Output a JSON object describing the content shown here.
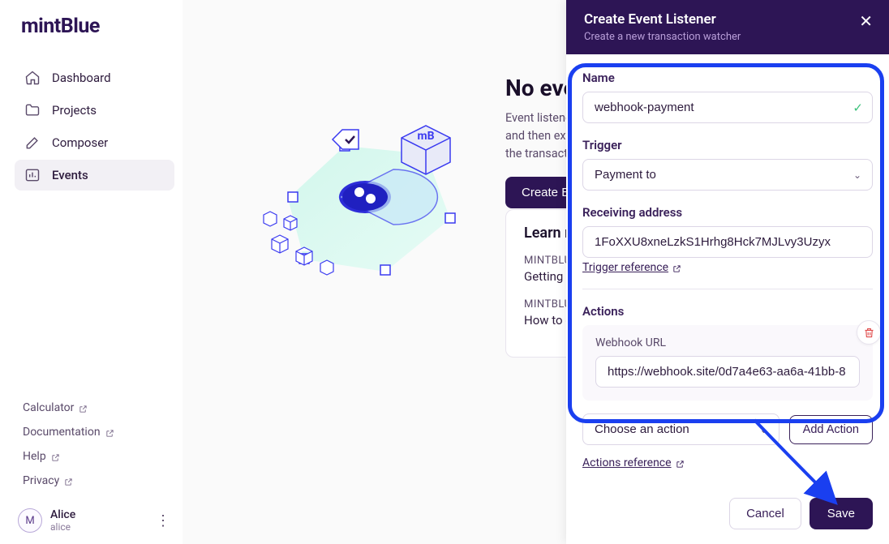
{
  "brand": "mintBlue",
  "sidebar": {
    "nav": [
      {
        "label": "Dashboard",
        "name": "sidebar-item-dashboard"
      },
      {
        "label": "Projects",
        "name": "sidebar-item-projects"
      },
      {
        "label": "Composer",
        "name": "sidebar-item-composer"
      },
      {
        "label": "Events",
        "name": "sidebar-item-events"
      }
    ],
    "links": [
      {
        "label": "Calculator"
      },
      {
        "label": "Documentation"
      },
      {
        "label": "Help"
      },
      {
        "label": "Privacy"
      }
    ],
    "user": {
      "initial": "M",
      "name": "Alice",
      "handle": "alice"
    }
  },
  "main": {
    "title": "No events",
    "desc_line1": "Event listeners watch for conditions",
    "desc_line2": "and then execute actions based on",
    "desc_line3": "the transactions.",
    "create_button": "Create Event",
    "learn_title": "Learn more",
    "learn_items": [
      {
        "tag": "MINTBLUE",
        "text": "Getting started"
      },
      {
        "tag": "MINTBLUE",
        "text": "How to create"
      }
    ]
  },
  "panel": {
    "title": "Create Event Listener",
    "subtitle": "Create a new transaction watcher",
    "name_label": "Name",
    "name_value": "webhook-payment",
    "trigger_label": "Trigger",
    "trigger_value": "Payment to",
    "address_label": "Receiving address",
    "address_value": "1FoXXU8xneLzkS1Hrhg8Hck7MJLvy3Uzyx",
    "trigger_ref": "Trigger reference",
    "actions_label": "Actions",
    "webhook_label": "Webhook URL",
    "webhook_value": "https://webhook.site/0d7a4e63-aa6a-41bb-8",
    "choose_action": "Choose an action",
    "add_action": "Add Action",
    "actions_ref": "Actions reference",
    "cancel": "Cancel",
    "save": "Save"
  }
}
